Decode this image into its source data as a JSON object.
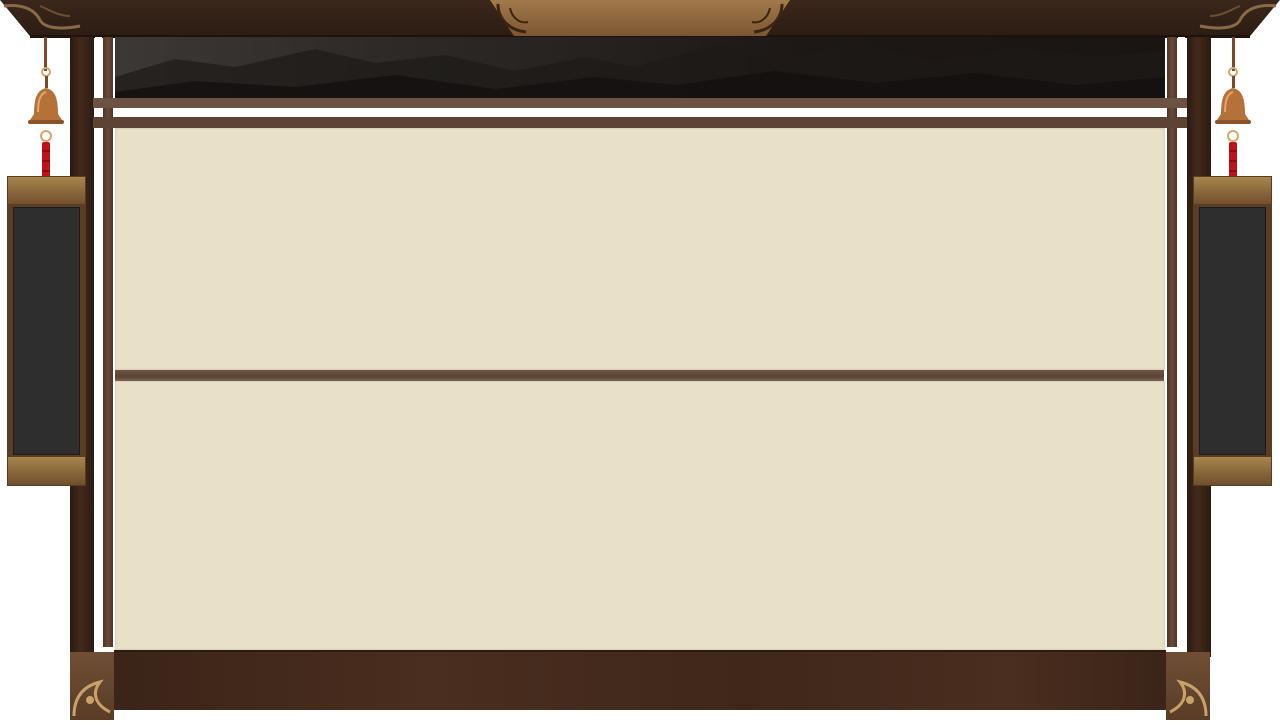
{
  "frame": {
    "style": "traditional-wooden-pavilion",
    "colors": {
      "wood_dark": "#2c1c13",
      "wood_mid": "#684b3a",
      "gold_trim": "#a27a4c",
      "parchment": "#e8e1c8",
      "plaque_board": "#2e2e2e",
      "tassel_red": "#c0121a"
    },
    "icons": {
      "roof_center": "scroll-ornament-icon",
      "bell": "bell-icon",
      "corner": "corner-ornament-icon"
    }
  },
  "banner": {
    "scene": "dark-mountain-landscape"
  },
  "panels": {
    "top": {
      "text": ""
    },
    "bottom": {
      "text": ""
    }
  },
  "plaques": {
    "left": {
      "text": ""
    },
    "right": {
      "text": ""
    }
  }
}
